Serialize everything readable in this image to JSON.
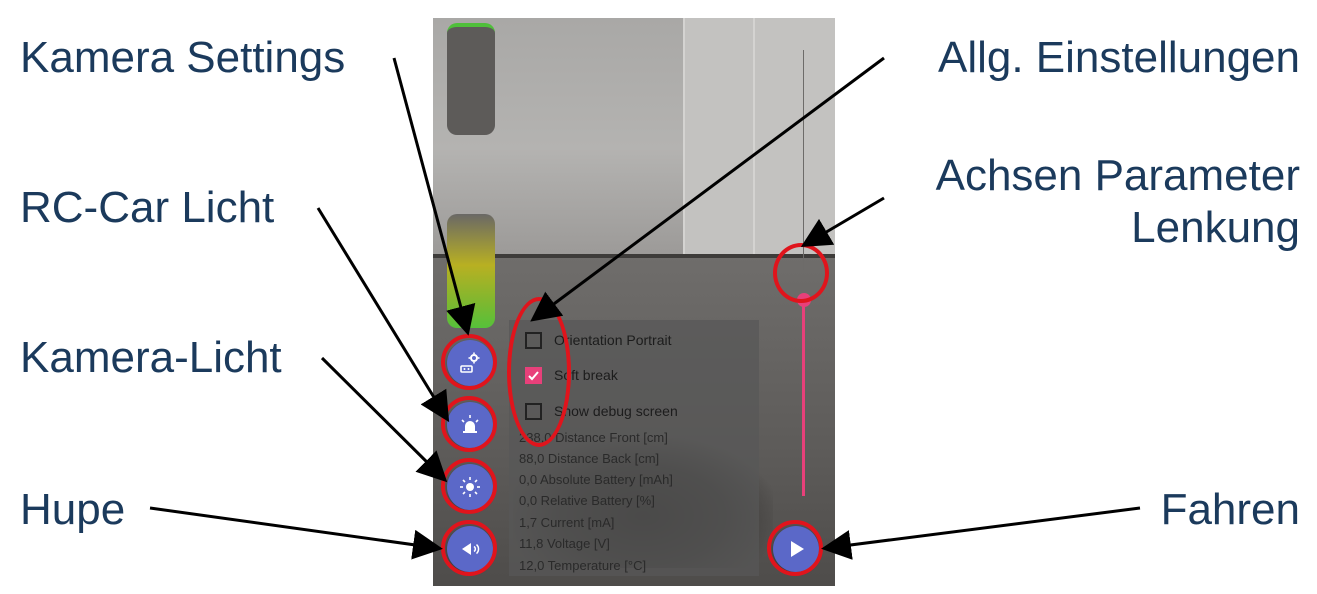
{
  "callouts": {
    "camera_settings": "Kamera Settings",
    "rc_car_light": "RC-Car Licht",
    "camera_light": "Kamera-Licht",
    "horn": "Hupe",
    "general_settings": "Allg. Einstellungen",
    "axis_params_line1": "Achsen Parameter",
    "axis_params_line2": "Lenkung",
    "drive": "Fahren"
  },
  "settings_panel": {
    "options": [
      {
        "label": "Orientation Portrait",
        "checked": false
      },
      {
        "label": "Soft break",
        "checked": true
      },
      {
        "label": "Show debug screen",
        "checked": false
      }
    ],
    "debug_values": [
      "238,0 Distance Front [cm]",
      "88,0 Distance Back [cm]",
      "0,0 Absolute Battery [mAh]",
      "0,0 Relative Battery [%]",
      "1,7 Current [mA]",
      "11,8 Voltage [V]",
      "12,0 Temperature [°C]"
    ]
  },
  "steering_slider": {
    "level": 0.56
  },
  "colors": {
    "fab": "#5b68c8",
    "accent": "#e8407a",
    "annotation_ring": "#e0141c",
    "callout_text": "#1b3a5c"
  },
  "icons": {
    "camera_settings": "camera-settings-icon",
    "rc_car_light": "siren-light-icon",
    "camera_light": "sun-icon",
    "horn": "speaker-icon",
    "drive": "play-icon"
  }
}
